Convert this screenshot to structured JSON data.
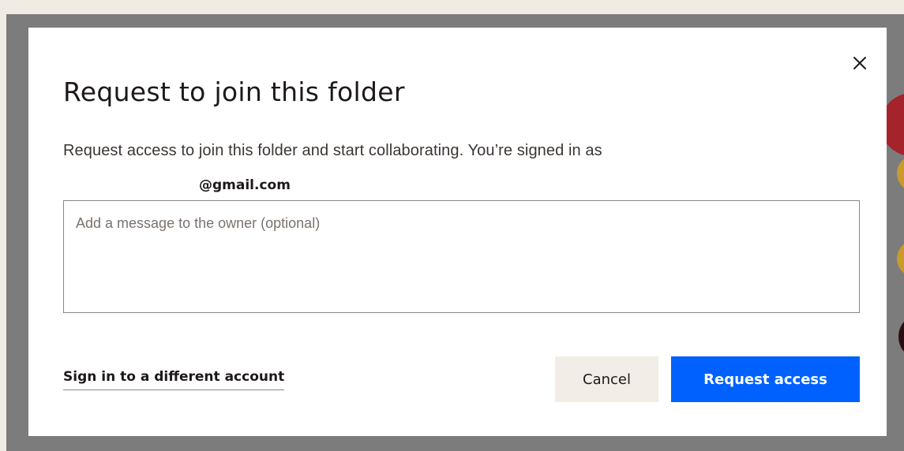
{
  "modal": {
    "title": "Request to join this folder",
    "description": "Request access to join this folder and start collaborating. You’re signed in as",
    "email": "@gmail.com",
    "message_placeholder": "Add a message to the owner (optional)",
    "message_value": "",
    "close_icon": "close-icon",
    "alt_account_label": "Sign in to a different account",
    "cancel_label": "Cancel",
    "request_label": "Request access"
  },
  "colors": {
    "primary": "#0061fe",
    "secondary_button": "#f2ede6",
    "text": "#1e1919",
    "backdrop": "#7c7c7c",
    "page_background": "#f0ebe3",
    "decor_red": "#a5232a",
    "decor_yellow": "#c99a2e",
    "decor_dark": "#2a0f12"
  }
}
